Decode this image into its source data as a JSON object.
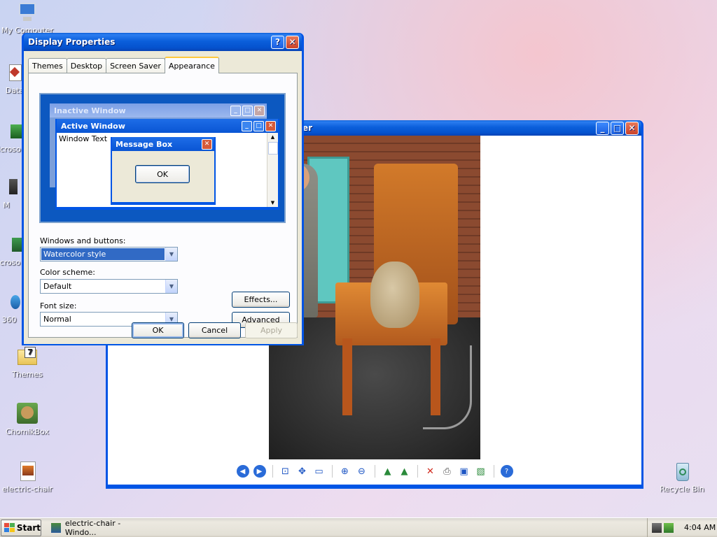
{
  "desktop": {
    "icons": [
      {
        "label": "My Computer",
        "icon": "computer-icon"
      },
      {
        "label": "Data",
        "icon": "data-icon"
      },
      {
        "label": "Microso Gr",
        "icon": "app-icon"
      },
      {
        "label": "M",
        "icon": "app-icon"
      },
      {
        "label": "Microso Ba",
        "icon": "app-icon"
      },
      {
        "label": "360",
        "icon": "app-icon"
      },
      {
        "label": "Themes",
        "icon": "themes-folder-icon"
      },
      {
        "label": "ChomikBox",
        "icon": "chomikbox-icon"
      },
      {
        "label": "electric-chair",
        "icon": "image-file-icon"
      },
      {
        "label": "Recycle Bin",
        "icon": "recycle-bin-icon"
      }
    ]
  },
  "viewer": {
    "title_suffix": "er",
    "toolbar": [
      "previous-image",
      "next-image",
      "best-fit",
      "actual-size",
      "slideshow",
      "zoom-in",
      "zoom-out",
      "rotate-clockwise",
      "rotate-counterclockwise",
      "delete",
      "print",
      "copy-to",
      "open-for-editing",
      "help"
    ]
  },
  "display_properties": {
    "title": "Display Properties",
    "tabs": [
      "Themes",
      "Desktop",
      "Screen Saver",
      "Appearance"
    ],
    "active_tab": "Appearance",
    "preview": {
      "inactive_title": "Inactive Window",
      "active_title": "Active Window",
      "window_text": "Window Text",
      "message_box_title": "Message Box",
      "message_box_ok": "OK"
    },
    "windows_buttons_label": "Windows and buttons:",
    "windows_buttons_value": "Watercolor style",
    "color_scheme_label": "Color scheme:",
    "color_scheme_value": "Default",
    "font_size_label": "Font size:",
    "font_size_value": "Normal",
    "effects_label": "Effects...",
    "advanced_label": "Advanced",
    "ok_label": "OK",
    "cancel_label": "Cancel",
    "apply_label": "Apply"
  },
  "taskbar": {
    "start_label": "Start",
    "task_label": "electric-chair - Windo...",
    "clock": "4:04 AM"
  },
  "colors": {
    "xp_blue": "#0055e5",
    "dialog_bg": "#ece9d8",
    "selection": "#316ac5"
  }
}
